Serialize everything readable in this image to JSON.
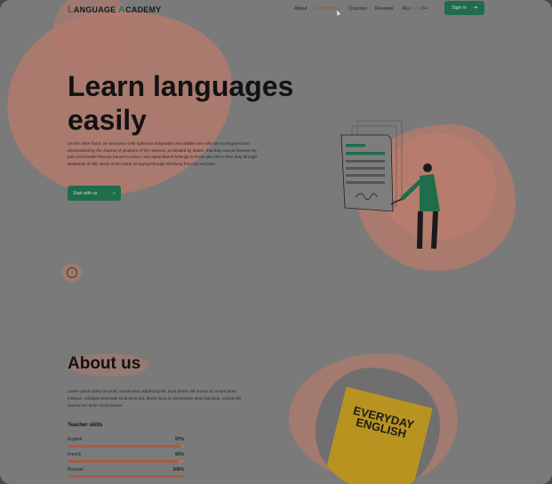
{
  "brand": {
    "logo_text_1": "L",
    "logo_text_2": "ANGUAGE ",
    "logo_text_3": "A",
    "logo_text_4": "CADEMY"
  },
  "nav": {
    "items": [
      {
        "label": "About"
      },
      {
        "label": "Advantages",
        "active": true
      },
      {
        "label": "Courses"
      },
      {
        "label": "Reviews"
      }
    ],
    "languages": {
      "ru": "Ru",
      "sep1": " / ",
      "en": "En",
      "sep2": " / ",
      "fr": "Fr"
    },
    "signin_label": "Sign in"
  },
  "hero": {
    "title": "Learn languages easily",
    "paragraph": "On the other hand, we denounce with righteous indignation and dislike men who are so beguiled and demoralized by the charms of pleasure of the moment, so blinded by desire, that they cannot foresee the pain and trouble that are bound to ensue; and equal blame belongs to those who fail in their duty through weakness of will, which is the same as saying through shrinking from toil and pain.",
    "cta_label": "Start with us",
    "cta_icon": "arrow-right-icon",
    "scroll_icon": "arrow-down-icon"
  },
  "about": {
    "title": "About us",
    "paragraph": "Lorem ipsum dolor sit amet, consectetur adipiscing elit. Duis donec vel ornare ac ornare diam tristique. Volutpat venenatis sit at amet dui. Morbi risus ac elementum amet faucibus. Luctus nisl viverra orci dolor morbi iaculis.",
    "skills_title": "Teacher skills",
    "skills": [
      {
        "name": "English",
        "value": "97%",
        "fraction": 0.97
      },
      {
        "name": "French",
        "value": "95%",
        "fraction": 0.95
      },
      {
        "name": "Russian",
        "value": "100%",
        "fraction": 1.0
      }
    ],
    "book_text": "EVERYDAY ENGLISH"
  },
  "colors": {
    "accent": "#1f6d4a",
    "highlight": "#a0533e",
    "blob": "#b37a6c",
    "overlay": "#4b4b4b"
  }
}
